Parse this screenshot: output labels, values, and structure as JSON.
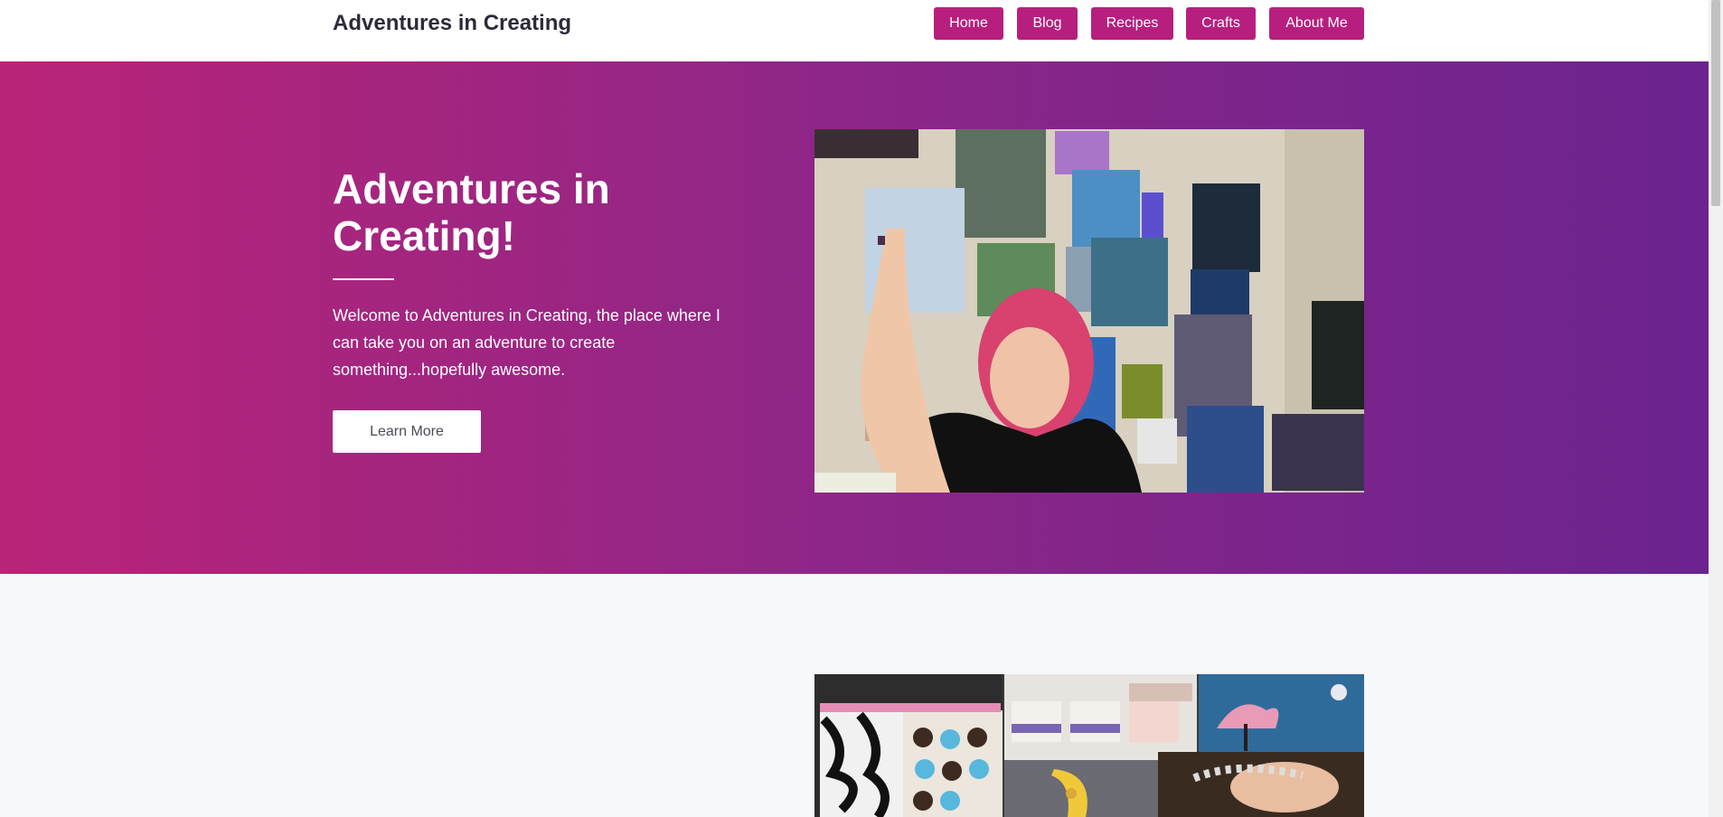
{
  "navbar": {
    "brand": "Adventures in Creating",
    "items": [
      {
        "label": "Home"
      },
      {
        "label": "Blog"
      },
      {
        "label": "Recipes"
      },
      {
        "label": "Crafts"
      },
      {
        "label": "About Me"
      }
    ]
  },
  "hero": {
    "title": "Adventures in Creating!",
    "description": "Welcome to Adventures in Creating, the place where I can take you on an adventure to create something...hopefully awesome.",
    "button_label": "Learn More"
  },
  "colors": {
    "accent": "#b71f7e",
    "gradient_start": "#b92478",
    "gradient_end": "#6b238f",
    "section_background": "#f7f8fa"
  }
}
